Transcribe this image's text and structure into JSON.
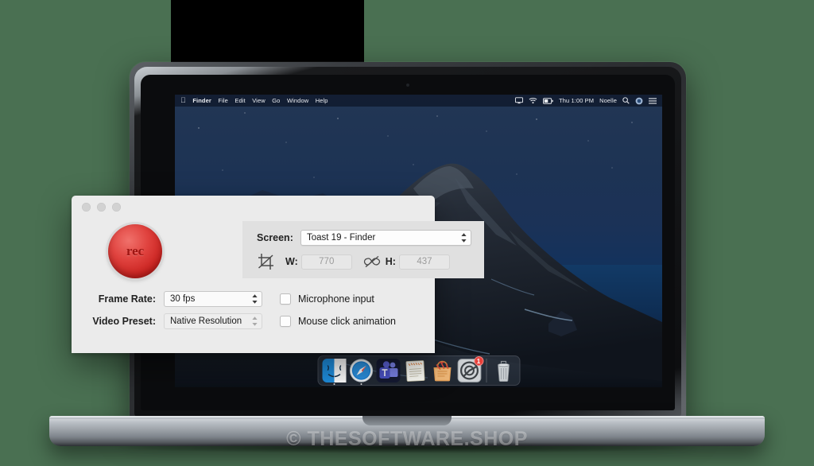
{
  "background": {
    "color": "#4a7052"
  },
  "device": {
    "type": "macbook-pro",
    "watermark": "© THESOFTWARE.SHOP"
  },
  "desktop": {
    "wallpaper_name": "macOS Catalina Island",
    "menubar": {
      "apple_logo": "",
      "items": [
        "Finder",
        "File",
        "Edit",
        "View",
        "Go",
        "Window",
        "Help"
      ],
      "status": {
        "screen_mirroring_icon": "screen-mirroring-icon",
        "wifi_icon": "wifi-icon",
        "battery_icon": "battery-icon",
        "clock": "Thu 1:00 PM",
        "user": "Noelle",
        "search_icon": "spotlight-search-icon",
        "siri_icon": "siri-icon",
        "control_center_icon": "control-center-icon"
      }
    },
    "dock": {
      "items": [
        {
          "name": "Finder",
          "running": true
        },
        {
          "name": "Safari",
          "running": true
        },
        {
          "name": "Microsoft Teams",
          "running": false
        },
        {
          "name": "Stickies",
          "running": false
        },
        {
          "name": "Toast",
          "running": false
        },
        {
          "name": "System Preferences",
          "running": false,
          "badge": "1"
        }
      ],
      "trash": {
        "name": "Trash"
      }
    }
  },
  "dialog": {
    "window_controls": [
      "close",
      "minimize",
      "zoom"
    ],
    "record_button": {
      "label": "rec",
      "color": "#d7302c"
    },
    "screen": {
      "label": "Screen:",
      "value": "Toast 19 - Finder",
      "options": [
        "Toast 19 - Finder"
      ]
    },
    "crop_icon": "crop-disabled-icon",
    "link_icon": "aspect-ratio-unlinked-icon",
    "width": {
      "label": "W:",
      "value": "770"
    },
    "height": {
      "label": "H:",
      "value": "437"
    },
    "frame_rate": {
      "label": "Frame Rate:",
      "value": "30 fps",
      "options": [
        "30 fps"
      ]
    },
    "video_preset": {
      "label": "Video Preset:",
      "value": "Native Resolution",
      "options": [
        "Native Resolution"
      ]
    },
    "microphone": {
      "label": "Microphone input",
      "checked": false
    },
    "mouse_click": {
      "label": "Mouse click animation",
      "checked": false
    }
  }
}
